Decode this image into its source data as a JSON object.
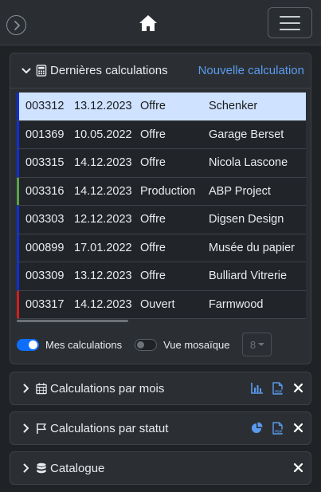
{
  "panel_main": {
    "title": "Dernières calculations",
    "new_link": "Nouvelle calculation",
    "rows": [
      {
        "num": "003312",
        "date": "13.12.2023",
        "type": "Offre",
        "client": "Schenker",
        "status_color": "#0d2fd8",
        "selected": true
      },
      {
        "num": "001369",
        "date": "10.05.2022",
        "type": "Offre",
        "client": "Garage Berset",
        "status_color": "#0d2fd8",
        "selected": false
      },
      {
        "num": "003315",
        "date": "14.12.2023",
        "type": "Offre",
        "client": "Nicola Lascone",
        "status_color": "#0d2fd8",
        "selected": false
      },
      {
        "num": "003316",
        "date": "14.12.2023",
        "type": "Production",
        "client": "ABP Project",
        "status_color": "#5aa14a",
        "selected": false
      },
      {
        "num": "003303",
        "date": "12.12.2023",
        "type": "Offre",
        "client": "Digsen Design",
        "status_color": "#0d2fd8",
        "selected": false
      },
      {
        "num": "000899",
        "date": "17.01.2022",
        "type": "Offre",
        "client": "Musée du papier",
        "status_color": "#0d2fd8",
        "selected": false
      },
      {
        "num": "003309",
        "date": "13.12.2023",
        "type": "Offre",
        "client": "Bulliard Vitrerie",
        "status_color": "#0d2fd8",
        "selected": false
      },
      {
        "num": "003317",
        "date": "14.12.2023",
        "type": "Ouvert",
        "client": "Farmwood",
        "status_color": "#d11f1f",
        "selected": false
      }
    ],
    "toggle_mine_label": "Mes calculations",
    "toggle_mine_on": true,
    "toggle_mosaic_label": "Vue mosaïque",
    "toggle_mosaic_on": false,
    "page_size_value": "8"
  },
  "panels": [
    {
      "title": "Calculations par mois",
      "icon": "calendar-icon",
      "actions": [
        "bar-chart-icon",
        "pdf-icon",
        "close-icon"
      ]
    },
    {
      "title": "Calculations par statut",
      "icon": "flag-icon",
      "actions": [
        "pie-chart-icon",
        "pdf-icon",
        "close-icon"
      ]
    },
    {
      "title": "Catalogue",
      "icon": "database-icon",
      "actions": [
        "close-icon"
      ]
    }
  ],
  "colors": {
    "accent": "#0d6efd",
    "link": "#5a9bf0"
  }
}
